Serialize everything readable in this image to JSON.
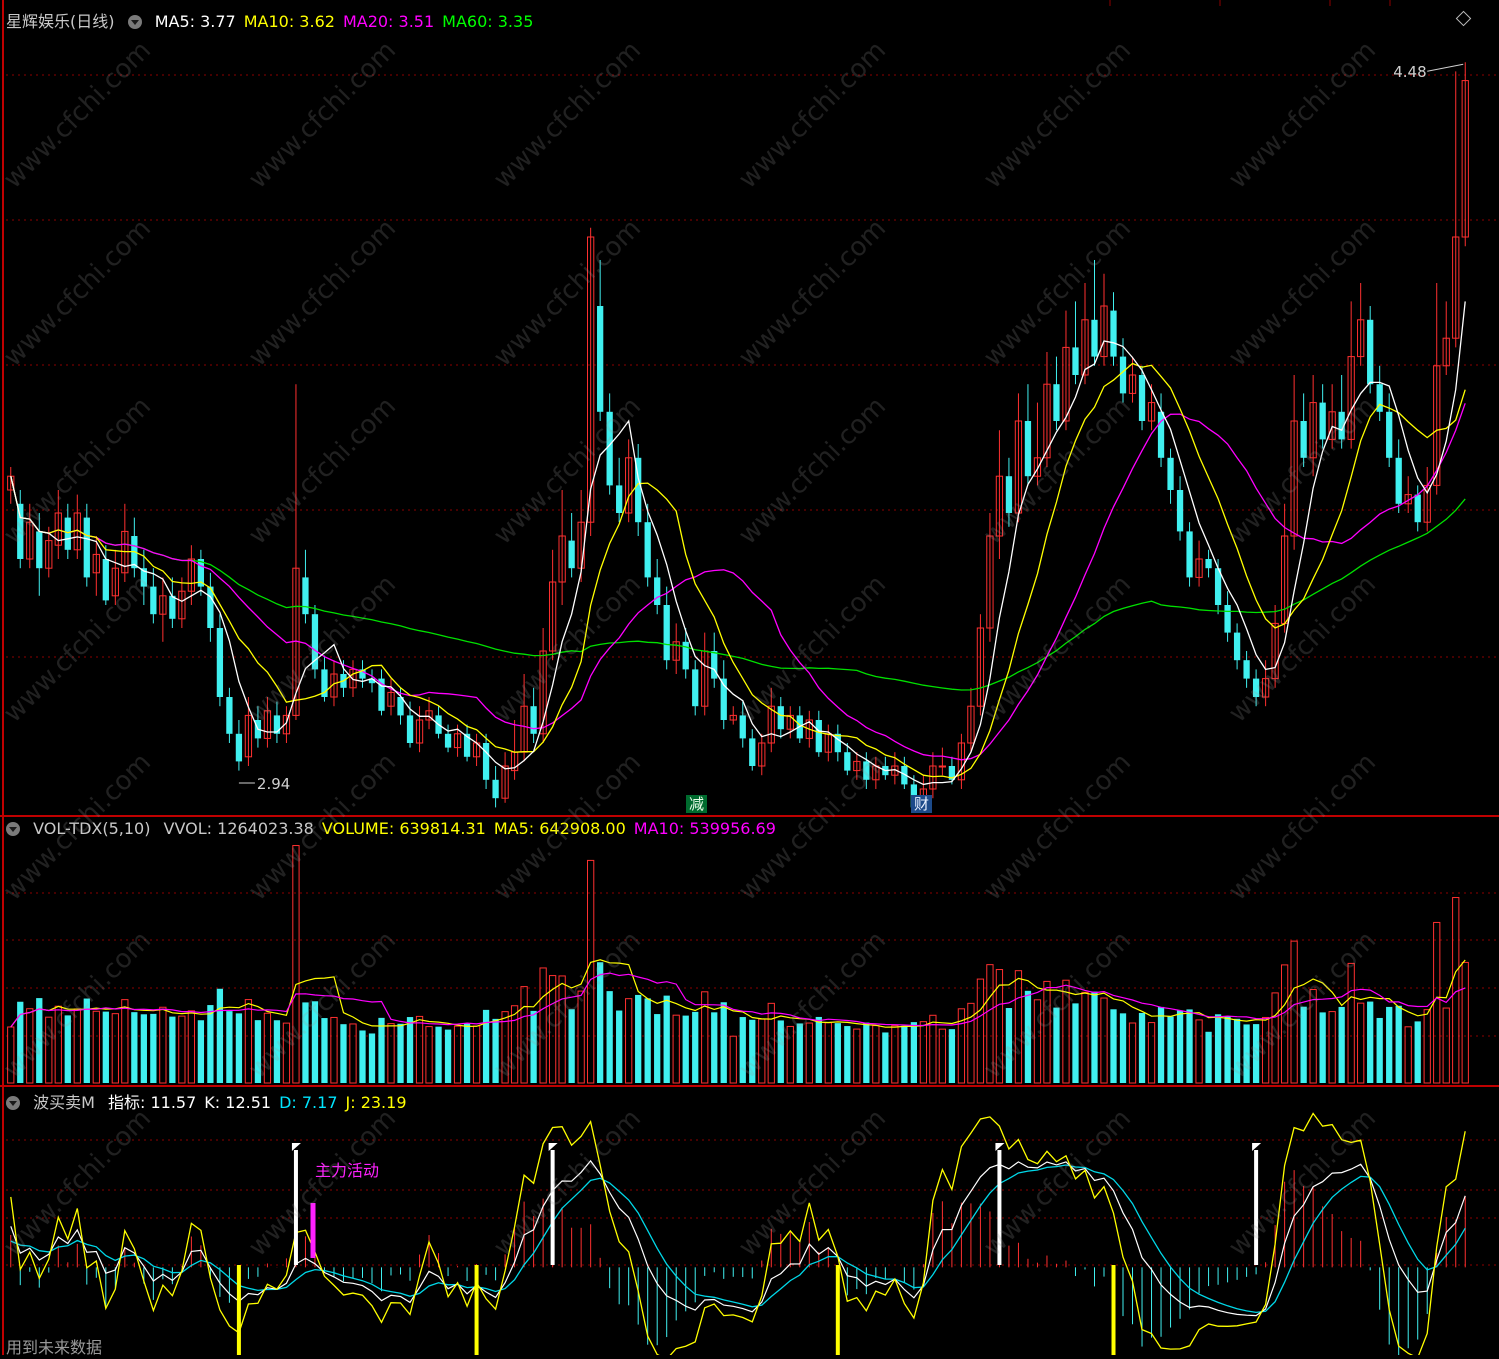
{
  "price_panel": {
    "stock_name": "星辉娱乐(日线)",
    "indicators": [
      {
        "label": "MA5: 3.77",
        "color": "#ffffff"
      },
      {
        "label": "MA10: 3.62",
        "color": "#ffff00"
      },
      {
        "label": "MA20: 3.51",
        "color": "#ff00ff"
      },
      {
        "label": "MA60: 3.35",
        "color": "#00ff00"
      }
    ],
    "high_label": "4.48",
    "low_label": "2.94",
    "event_tag_reduce": "减",
    "event_tag_finance": "财"
  },
  "volume_panel": {
    "indicator_name": "VOL-TDX(5,10)",
    "values": [
      {
        "label": "VVOL: 1264023.38",
        "color": "#c8c8c8"
      },
      {
        "label": "VOLUME: 639814.31",
        "color": "#ffff00"
      },
      {
        "label": "MA5: 642908.00",
        "color": "#ffff00"
      },
      {
        "label": "MA10: 539956.69",
        "color": "#ff00ff"
      }
    ]
  },
  "bmm_panel": {
    "indicator_name": "波买卖M",
    "values": [
      {
        "label": "指标: 11.57",
        "color": "#ffffff"
      },
      {
        "label": "K: 12.51",
        "color": "#ffffff"
      },
      {
        "label": "D: 7.17",
        "color": "#00e5ff"
      },
      {
        "label": "J: 23.19",
        "color": "#ffff00"
      }
    ],
    "annotation": "主力活动"
  },
  "footer_text": "用到未来数据",
  "watermark": "www.cfchi.com",
  "colors": {
    "up": "#ff3030",
    "down": "#40f0f0",
    "ma5": "#ffffff",
    "ma10": "#ffff00",
    "ma20": "#ff00ff",
    "ma60": "#00e000",
    "grid": "#8b0000",
    "border": "#c00000"
  },
  "chart_data": [
    {
      "type": "candlestick",
      "title": "星辉娱乐(日线)",
      "ylim": [
        2.85,
        4.55
      ],
      "annotations": [
        {
          "label": "4.48",
          "kind": "max"
        },
        {
          "label": "2.94",
          "kind": "min"
        }
      ],
      "series": [
        {
          "name": "MA5",
          "last": 3.77
        },
        {
          "name": "MA10",
          "last": 3.62
        },
        {
          "name": "MA20",
          "last": 3.51
        },
        {
          "name": "MA60",
          "last": 3.35
        }
      ],
      "candles": [
        [
          3.55,
          3.58,
          3.52,
          3.6,
          3.4
        ],
        [
          3.52,
          3.4,
          3.38,
          3.55,
          3.3
        ],
        [
          3.4,
          3.48,
          3.38,
          3.52,
          3.35
        ],
        [
          3.46,
          3.38,
          3.32,
          3.5,
          3.28
        ],
        [
          3.38,
          3.44,
          3.36,
          3.47,
          3.3
        ],
        [
          3.43,
          3.5,
          3.4,
          3.55,
          3.38
        ],
        [
          3.49,
          3.42,
          3.4,
          3.52,
          3.36
        ],
        [
          3.42,
          3.5,
          3.4,
          3.54,
          3.38
        ],
        [
          3.49,
          3.36,
          3.34,
          3.52,
          3.3
        ],
        [
          3.37,
          3.41,
          3.32,
          3.45,
          3.3
        ],
        [
          3.4,
          3.31,
          3.3,
          3.43,
          3.28
        ],
        [
          3.32,
          3.38,
          3.3,
          3.42,
          3.28
        ],
        [
          3.37,
          3.46,
          3.35,
          3.52,
          3.33
        ],
        [
          3.45,
          3.38,
          3.36,
          3.49,
          3.34
        ],
        [
          3.38,
          3.34,
          3.3,
          3.42,
          3.26
        ],
        [
          3.34,
          3.28,
          3.26,
          3.38,
          3.22
        ],
        [
          3.28,
          3.32,
          3.22,
          3.36,
          3.2
        ],
        [
          3.32,
          3.27,
          3.25,
          3.36,
          3.22
        ],
        [
          3.27,
          3.33,
          3.25,
          3.36,
          3.22
        ],
        [
          3.33,
          3.4,
          3.3,
          3.43,
          3.28
        ],
        [
          3.4,
          3.34,
          3.32,
          3.42,
          3.3
        ],
        [
          3.34,
          3.25,
          3.22,
          3.37,
          3.2
        ],
        [
          3.25,
          3.1,
          3.08,
          3.28,
          3.05
        ],
        [
          3.1,
          3.02,
          3.0,
          3.12,
          2.96
        ],
        [
          3.02,
          2.96,
          2.94,
          3.05,
          2.94
        ],
        [
          2.97,
          3.06,
          2.95,
          3.1,
          2.94
        ],
        [
          3.05,
          3.01,
          2.99,
          3.08,
          2.97
        ],
        [
          3.01,
          3.07,
          2.99,
          3.1,
          2.98
        ],
        [
          3.06,
          3.02,
          3.0,
          3.09,
          2.99
        ],
        [
          3.02,
          3.06,
          3.0,
          3.08,
          2.99
        ],
        [
          3.06,
          3.38,
          3.05,
          3.78,
          3.04
        ],
        [
          3.36,
          3.28,
          3.26,
          3.42,
          3.24
        ],
        [
          3.28,
          3.16,
          3.14,
          3.3,
          3.1
        ],
        [
          3.16,
          3.1,
          3.09,
          3.19,
          3.06
        ],
        [
          3.1,
          3.15,
          3.08,
          3.18,
          3.06
        ],
        [
          3.15,
          3.12,
          3.1,
          3.18,
          3.09
        ],
        [
          3.12,
          3.16,
          3.1,
          3.18,
          3.08
        ],
        [
          3.16,
          3.14,
          3.12,
          3.18,
          3.11
        ],
        [
          3.14,
          3.13,
          3.11,
          3.16,
          3.1
        ],
        [
          3.14,
          3.07,
          3.06,
          3.16,
          3.04
        ],
        [
          3.08,
          3.11,
          3.06,
          3.14,
          3.04
        ],
        [
          3.1,
          3.06,
          3.04,
          3.12,
          3.03
        ],
        [
          3.06,
          3.0,
          2.99,
          3.09,
          2.98
        ],
        [
          3.0,
          3.05,
          2.98,
          3.08,
          2.97
        ],
        [
          3.05,
          3.07,
          3.03,
          3.1,
          3.01
        ],
        [
          3.06,
          3.02,
          3.01,
          3.08,
          3.0
        ],
        [
          3.02,
          2.99,
          2.98,
          3.04,
          2.96
        ],
        [
          2.99,
          3.02,
          2.97,
          3.04,
          2.96
        ],
        [
          3.02,
          2.97,
          2.96,
          3.04,
          2.95
        ],
        [
          2.97,
          3.0,
          2.95,
          3.02,
          2.94
        ],
        [
          3.0,
          2.92,
          2.9,
          3.02,
          2.88
        ],
        [
          2.92,
          2.88,
          2.86,
          2.95,
          2.85
        ],
        [
          2.88,
          2.95,
          2.87,
          2.98,
          2.86
        ],
        [
          2.94,
          2.98,
          2.92,
          3.05,
          2.9
        ],
        [
          2.98,
          3.08,
          2.96,
          3.15,
          2.95
        ],
        [
          3.08,
          3.02,
          3.0,
          3.12,
          2.98
        ],
        [
          3.02,
          3.2,
          3.0,
          3.25,
          2.99
        ],
        [
          3.2,
          3.35,
          3.18,
          3.42,
          3.15
        ],
        [
          3.35,
          3.45,
          3.3,
          3.55,
          3.28
        ],
        [
          3.44,
          3.38,
          3.36,
          3.5,
          3.33
        ],
        [
          3.38,
          3.48,
          3.35,
          3.55,
          3.33
        ],
        [
          3.48,
          4.1,
          3.45,
          4.12,
          3.42
        ],
        [
          3.95,
          3.72,
          3.7,
          4.05,
          3.68
        ],
        [
          3.72,
          3.56,
          3.54,
          3.76,
          3.5
        ],
        [
          3.56,
          3.5,
          3.48,
          3.62,
          3.45
        ],
        [
          3.5,
          3.62,
          3.48,
          3.66,
          3.46
        ],
        [
          3.62,
          3.48,
          3.45,
          3.65,
          3.42
        ],
        [
          3.48,
          3.36,
          3.34,
          3.52,
          3.3
        ],
        [
          3.36,
          3.3,
          3.28,
          3.4,
          3.26
        ],
        [
          3.3,
          3.18,
          3.16,
          3.34,
          3.12
        ],
        [
          3.18,
          3.22,
          3.15,
          3.26,
          3.12
        ],
        [
          3.22,
          3.16,
          3.14,
          3.25,
          3.12
        ],
        [
          3.16,
          3.08,
          3.06,
          3.18,
          3.04
        ],
        [
          3.08,
          3.2,
          3.06,
          3.24,
          3.05
        ],
        [
          3.2,
          3.14,
          3.12,
          3.24,
          3.1
        ],
        [
          3.14,
          3.05,
          3.03,
          3.18,
          3.02
        ],
        [
          3.05,
          3.06,
          3.04,
          3.08,
          3.0
        ],
        [
          3.06,
          3.01,
          2.99,
          3.09,
          2.98
        ],
        [
          3.01,
          2.95,
          2.94,
          3.03,
          2.93
        ],
        [
          2.95,
          3.0,
          2.93,
          3.02,
          2.92
        ],
        [
          3.0,
          3.08,
          2.98,
          3.12,
          2.97
        ],
        [
          3.08,
          3.03,
          3.01,
          3.1,
          3.0
        ],
        [
          3.03,
          3.06,
          3.01,
          3.08,
          3.0
        ],
        [
          3.06,
          3.01,
          3.0,
          3.08,
          2.99
        ],
        [
          3.01,
          3.05,
          2.99,
          3.07,
          2.98
        ],
        [
          3.05,
          2.98,
          2.97,
          3.07,
          2.96
        ],
        [
          2.98,
          3.02,
          2.96,
          3.04,
          2.95
        ],
        [
          3.02,
          2.98,
          2.96,
          3.04,
          2.95
        ],
        [
          2.98,
          2.94,
          2.93,
          3.0,
          2.92
        ],
        [
          2.94,
          2.96,
          2.92,
          2.98,
          2.91
        ],
        [
          2.96,
          2.92,
          2.9,
          2.98,
          2.89
        ],
        [
          2.92,
          2.95,
          2.9,
          2.97,
          2.89
        ],
        [
          2.95,
          2.93,
          2.92,
          2.97,
          2.91
        ],
        [
          2.93,
          2.95,
          2.91,
          2.98,
          2.9
        ],
        [
          2.95,
          2.91,
          2.9,
          2.97,
          2.89
        ],
        [
          2.91,
          2.86,
          2.85,
          2.93,
          2.84
        ],
        [
          2.86,
          2.9,
          2.85,
          2.93,
          2.84
        ],
        [
          2.9,
          2.95,
          2.88,
          2.98,
          2.87
        ],
        [
          2.95,
          2.95,
          2.93,
          2.99,
          2.92
        ],
        [
          2.95,
          2.92,
          2.91,
          2.97,
          2.9
        ],
        [
          2.92,
          3.0,
          2.9,
          3.02,
          2.89
        ],
        [
          3.0,
          3.08,
          2.98,
          3.12,
          2.97
        ],
        [
          3.08,
          3.25,
          3.06,
          3.28,
          3.05
        ],
        [
          3.25,
          3.45,
          3.22,
          3.5,
          3.2
        ],
        [
          3.45,
          3.58,
          3.4,
          3.68,
          3.38
        ],
        [
          3.58,
          3.5,
          3.47,
          3.62,
          3.45
        ],
        [
          3.5,
          3.7,
          3.48,
          3.76,
          3.46
        ],
        [
          3.7,
          3.58,
          3.56,
          3.78,
          3.55
        ],
        [
          3.58,
          3.62,
          3.56,
          3.74,
          3.54
        ],
        [
          3.62,
          3.78,
          3.6,
          3.85,
          3.58
        ],
        [
          3.78,
          3.7,
          3.68,
          3.84,
          3.66
        ],
        [
          3.7,
          3.86,
          3.68,
          3.94,
          3.66
        ],
        [
          3.86,
          3.8,
          3.78,
          3.96,
          3.74
        ],
        [
          3.8,
          3.92,
          3.78,
          4.0,
          3.76
        ],
        [
          3.92,
          3.84,
          3.82,
          4.05,
          3.8
        ],
        [
          3.84,
          3.95,
          3.82,
          4.02,
          3.8
        ],
        [
          3.94,
          3.84,
          3.82,
          3.98,
          3.78
        ],
        [
          3.84,
          3.76,
          3.74,
          3.88,
          3.72
        ],
        [
          3.76,
          3.8,
          3.74,
          3.84,
          3.72
        ],
        [
          3.8,
          3.7,
          3.68,
          3.82,
          3.66
        ],
        [
          3.7,
          3.74,
          3.68,
          3.78,
          3.66
        ],
        [
          3.72,
          3.62,
          3.6,
          3.76,
          3.58
        ],
        [
          3.62,
          3.55,
          3.52,
          3.64,
          3.5
        ],
        [
          3.55,
          3.46,
          3.44,
          3.58,
          3.42
        ],
        [
          3.46,
          3.36,
          3.34,
          3.48,
          3.32
        ],
        [
          3.36,
          3.4,
          3.34,
          3.44,
          3.33
        ],
        [
          3.4,
          3.38,
          3.36,
          3.42,
          3.35
        ],
        [
          3.38,
          3.3,
          3.28,
          3.4,
          3.26
        ],
        [
          3.3,
          3.24,
          3.22,
          3.33,
          3.2
        ],
        [
          3.24,
          3.18,
          3.16,
          3.26,
          3.14
        ],
        [
          3.18,
          3.14,
          3.12,
          3.2,
          3.1
        ],
        [
          3.14,
          3.1,
          3.08,
          3.16,
          3.06
        ],
        [
          3.1,
          3.14,
          3.08,
          3.18,
          3.07
        ],
        [
          3.14,
          3.26,
          3.12,
          3.3,
          3.1
        ],
        [
          3.26,
          3.45,
          3.24,
          3.52,
          3.22
        ],
        [
          3.45,
          3.7,
          3.42,
          3.8,
          3.4
        ],
        [
          3.7,
          3.62,
          3.6,
          3.76,
          3.58
        ],
        [
          3.62,
          3.74,
          3.58,
          3.8,
          3.56
        ],
        [
          3.74,
          3.66,
          3.64,
          3.78,
          3.62
        ],
        [
          3.66,
          3.72,
          3.64,
          3.78,
          3.62
        ],
        [
          3.72,
          3.66,
          3.64,
          3.8,
          3.6
        ],
        [
          3.66,
          3.84,
          3.64,
          3.96,
          3.62
        ],
        [
          3.84,
          3.92,
          3.82,
          4.0,
          3.8
        ],
        [
          3.92,
          3.78,
          3.76,
          3.95,
          3.74
        ],
        [
          3.78,
          3.72,
          3.7,
          3.82,
          3.68
        ],
        [
          3.72,
          3.62,
          3.6,
          3.76,
          3.58
        ],
        [
          3.62,
          3.52,
          3.5,
          3.66,
          3.48
        ],
        [
          3.52,
          3.54,
          3.5,
          3.58,
          3.48
        ],
        [
          3.54,
          3.48,
          3.46,
          3.56,
          3.44
        ],
        [
          3.48,
          3.56,
          3.46,
          3.6,
          3.44
        ],
        [
          3.56,
          3.82,
          3.54,
          4.0,
          3.52
        ],
        [
          3.82,
          3.88,
          3.8,
          3.96,
          3.76
        ],
        [
          3.88,
          4.1,
          3.86,
          4.46,
          3.84
        ],
        [
          4.1,
          4.44,
          4.08,
          4.48,
          4.06
        ]
      ]
    },
    {
      "type": "bar",
      "title": "VOL-TDX(5,10)",
      "ylim": [
        0,
        1300000
      ],
      "series": [
        {
          "name": "VVOL",
          "last": 1264023.38
        },
        {
          "name": "VOLUME",
          "last": 639814.31
        },
        {
          "name": "MA5",
          "last": 642908.0
        },
        {
          "name": "MA10",
          "last": 539956.69
        }
      ]
    },
    {
      "type": "line",
      "title": "波买卖M",
      "ylim": [
        -40,
        80
      ],
      "series": [
        {
          "name": "指标",
          "last": 11.57
        },
        {
          "name": "K",
          "last": 12.51
        },
        {
          "name": "D",
          "last": 7.17
        },
        {
          "name": "J",
          "last": 23.19
        }
      ],
      "annotations": [
        {
          "label": "主力活动"
        }
      ]
    }
  ]
}
